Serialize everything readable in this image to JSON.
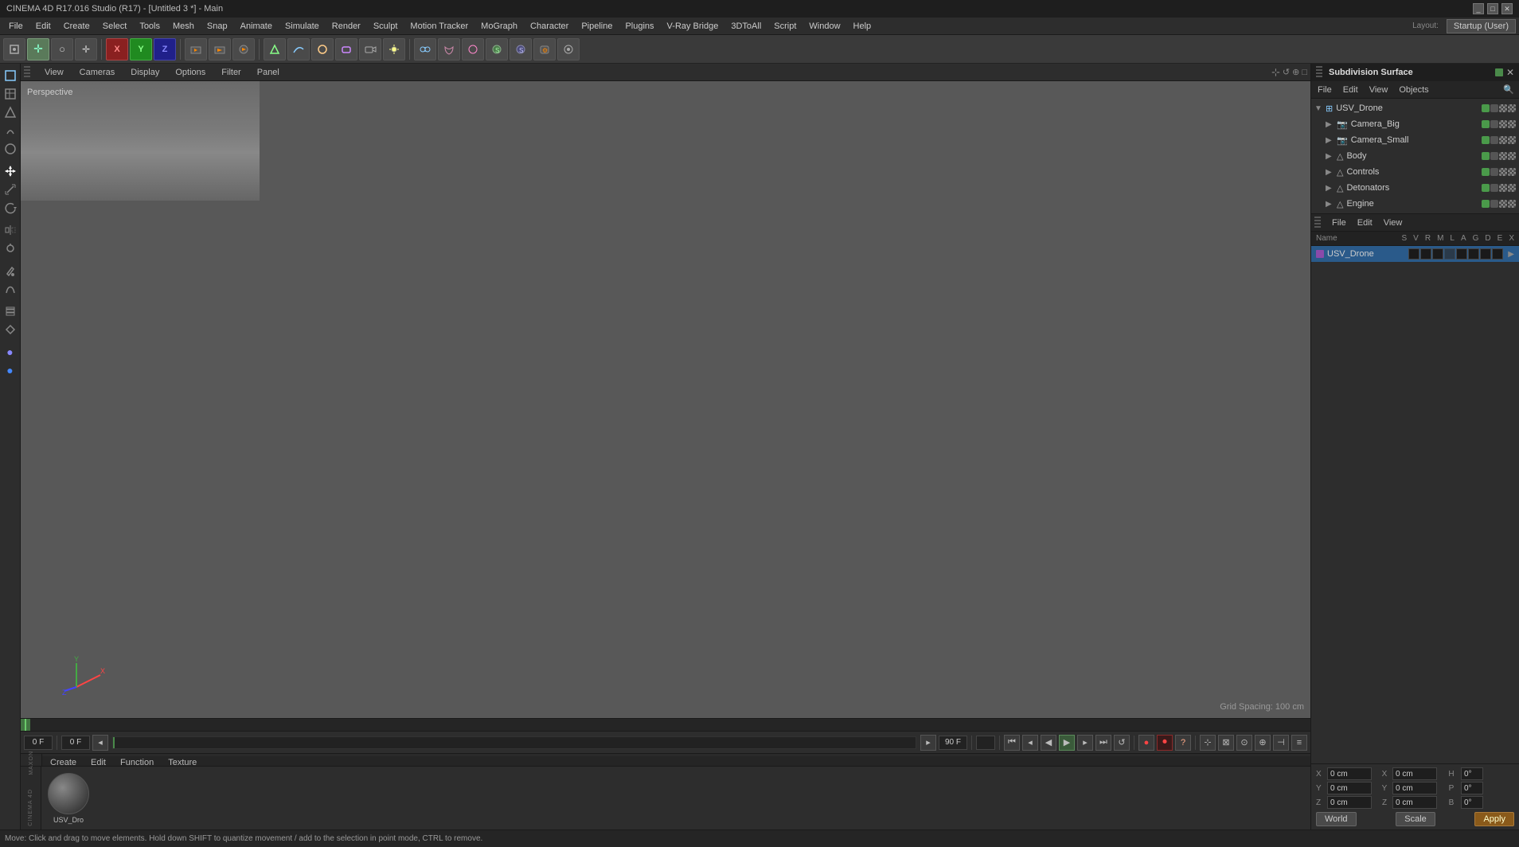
{
  "titleBar": {
    "title": "CINEMA 4D R17.016 Studio (R17) - [Untitled 3 *] - Main"
  },
  "menuBar": {
    "items": [
      "File",
      "Edit",
      "Create",
      "Select",
      "Tools",
      "Mesh",
      "Snap",
      "Animate",
      "Simulate",
      "Render",
      "Sculpt",
      "Motion Tracker",
      "MoGraph",
      "Character",
      "Pipeline",
      "Plugins",
      "V-Ray Bridge",
      "3DToAll",
      "Script",
      "Window",
      "Help"
    ]
  },
  "layout": {
    "label": "Layout:",
    "value": "Startup (User)"
  },
  "viewport": {
    "label": "Perspective",
    "gridSpacing": "Grid Spacing: 100 cm",
    "tabs": [
      "View",
      "Cameras",
      "Display",
      "Options",
      "Filter",
      "Panel"
    ]
  },
  "objectManager": {
    "title": "Subdivision Surface",
    "menuItems": [
      "File",
      "Edit",
      "View",
      "Objects"
    ],
    "objects": [
      {
        "name": "USV_Drone",
        "indent": 0,
        "expanded": true,
        "type": "group",
        "hasGreen": true
      },
      {
        "name": "Camera_Big",
        "indent": 1,
        "expanded": false,
        "type": "camera"
      },
      {
        "name": "Camera_Small",
        "indent": 1,
        "expanded": false,
        "type": "camera"
      },
      {
        "name": "Body",
        "indent": 1,
        "expanded": false,
        "type": "mesh"
      },
      {
        "name": "Controls",
        "indent": 1,
        "expanded": false,
        "type": "mesh"
      },
      {
        "name": "Detonators",
        "indent": 1,
        "expanded": false,
        "type": "mesh"
      },
      {
        "name": "Engine",
        "indent": 1,
        "expanded": false,
        "type": "mesh"
      }
    ]
  },
  "attributeManager": {
    "menuItems": [
      "File",
      "Edit",
      "View"
    ],
    "columns": [
      "Name",
      "S",
      "V",
      "R",
      "M",
      "L",
      "A",
      "G",
      "D",
      "E",
      "X"
    ],
    "selectedObject": "USV_Drone"
  },
  "coordinates": {
    "position": {
      "x": "0 cm",
      "y": "0 cm",
      "z": "0 cm"
    },
    "rotation": {
      "h": "0°",
      "p": "0°",
      "b": "0°"
    },
    "scale": {
      "x": "0 cm",
      "y": "0 cm",
      "z": "0 cm"
    },
    "worldLabel": "World",
    "scaleLabel": "Scale",
    "applyLabel": "Apply"
  },
  "materialPanel": {
    "tabs": [
      "Create",
      "Edit",
      "Function",
      "Texture"
    ],
    "material": {
      "name": "USV_Dro"
    }
  },
  "timeline": {
    "currentFrame": "0 F",
    "endFrame": "90 F",
    "playbackInput": "90 F",
    "frameInput": "0 F"
  },
  "statusBar": {
    "text": "Move: Click and drag to move elements. Hold down SHIFT to quantize movement / add to the selection in point mode, CTRL to remove."
  },
  "icons": {
    "cursor": "↖",
    "move": "✛",
    "scale": "⊡",
    "rotate": "↺",
    "x_axis": "X",
    "y_axis": "Y",
    "z_axis": "Z",
    "render": "▶",
    "camera": "📷",
    "light": "☀",
    "play": "▶",
    "stop": "■",
    "rewind": "⏮",
    "forward": "⏭"
  }
}
